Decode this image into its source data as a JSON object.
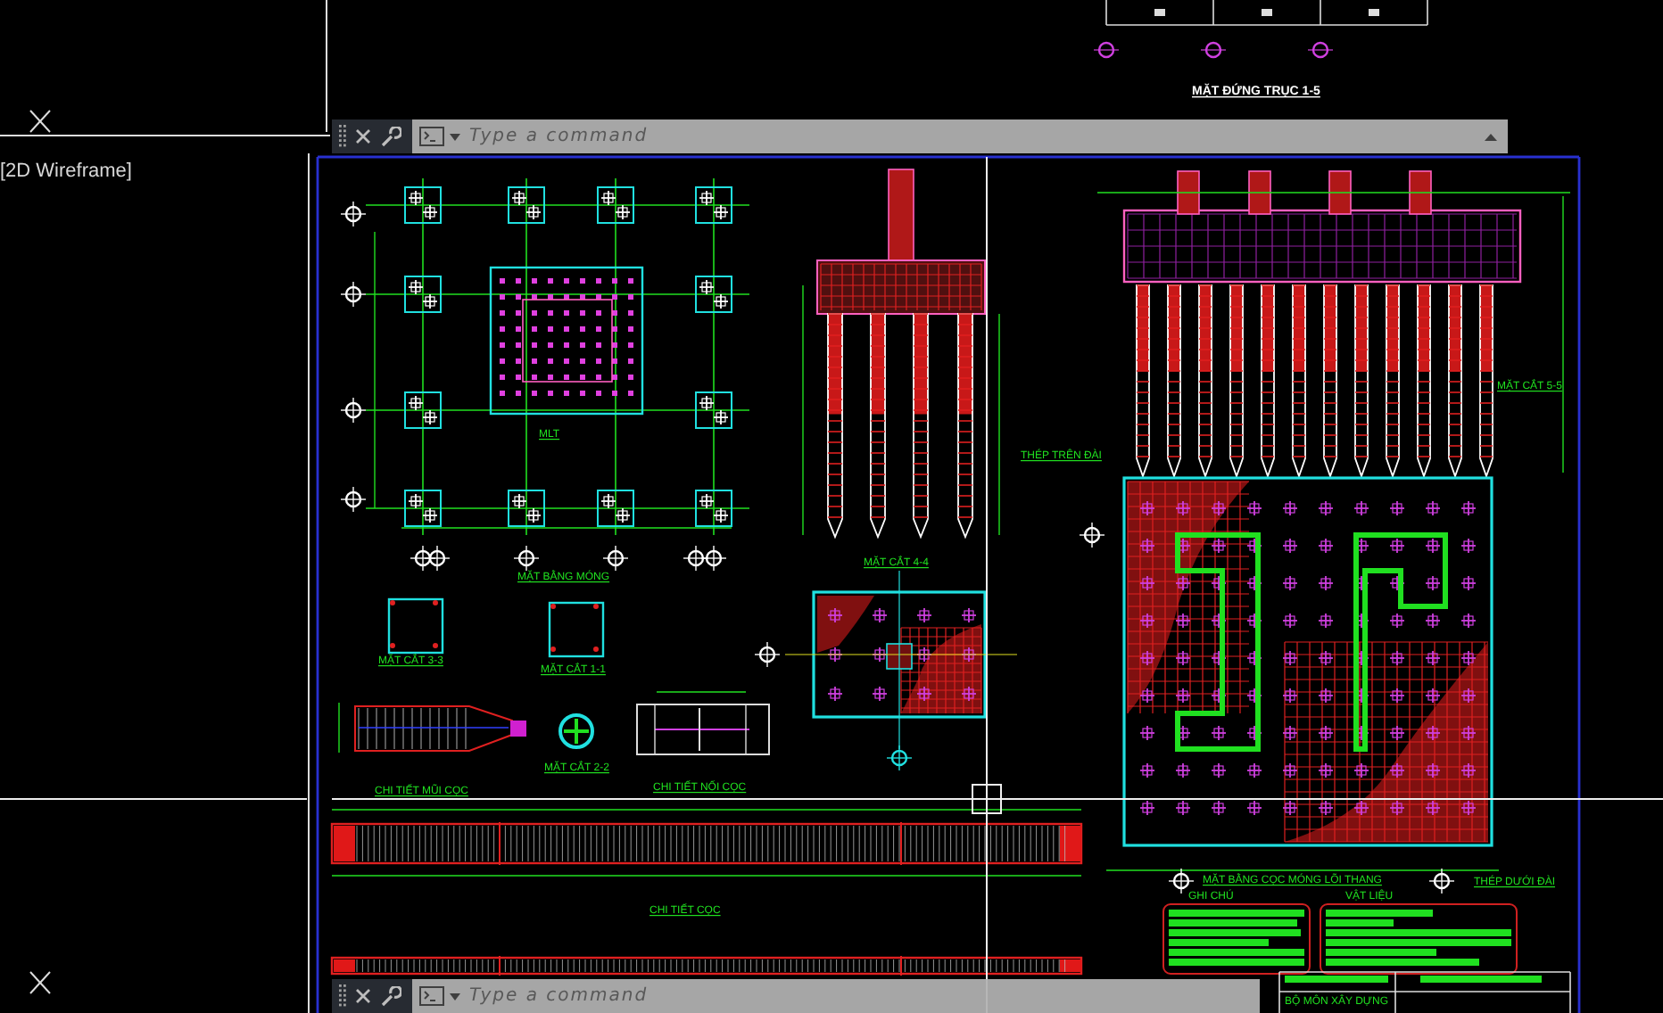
{
  "viewport": {
    "label": "[2D Wireframe]"
  },
  "command_bars": [
    {
      "placeholder": "Type a command",
      "collapse_arrow": true
    },
    {
      "placeholder": "Type a command",
      "collapse_arrow": false
    }
  ],
  "drawing_titles": [
    {
      "text": "MẶT ĐỨNG TRỤC 1-5",
      "kind": "sheet"
    },
    {
      "text": "MLT",
      "kind": "label"
    },
    {
      "text": "MẶT BẰNG MÓNG",
      "kind": "label"
    },
    {
      "text": "MẶT CẮT 4-4",
      "kind": "label"
    },
    {
      "text": "MẶT CẮT 5-5",
      "kind": "label"
    },
    {
      "text": "THÉP TRÊN ĐÀI",
      "kind": "label"
    },
    {
      "text": "MẶT CẮT 3-3",
      "kind": "label"
    },
    {
      "text": "MẶT CẮT 1-1",
      "kind": "label"
    },
    {
      "text": "MẶT CẮT 2-2",
      "kind": "label"
    },
    {
      "text": "CHI TIẾT MŨI CỌC",
      "kind": "label"
    },
    {
      "text": "CHI TIẾT NỐI CỌC",
      "kind": "label"
    },
    {
      "text": "MẶT BẰNG CỌC MÓNG LÕI THANG",
      "kind": "label"
    },
    {
      "text": "THÉP DƯỚI ĐÀI",
      "kind": "label"
    },
    {
      "text": "CHI TIẾT CỌC",
      "kind": "label"
    }
  ],
  "notes_panels": [
    {
      "title": "GHI CHÚ"
    },
    {
      "title": "VẬT LIỆU"
    }
  ],
  "title_block": {
    "cells": [
      "BỘ MÔN XÂY DỰNG"
    ]
  }
}
